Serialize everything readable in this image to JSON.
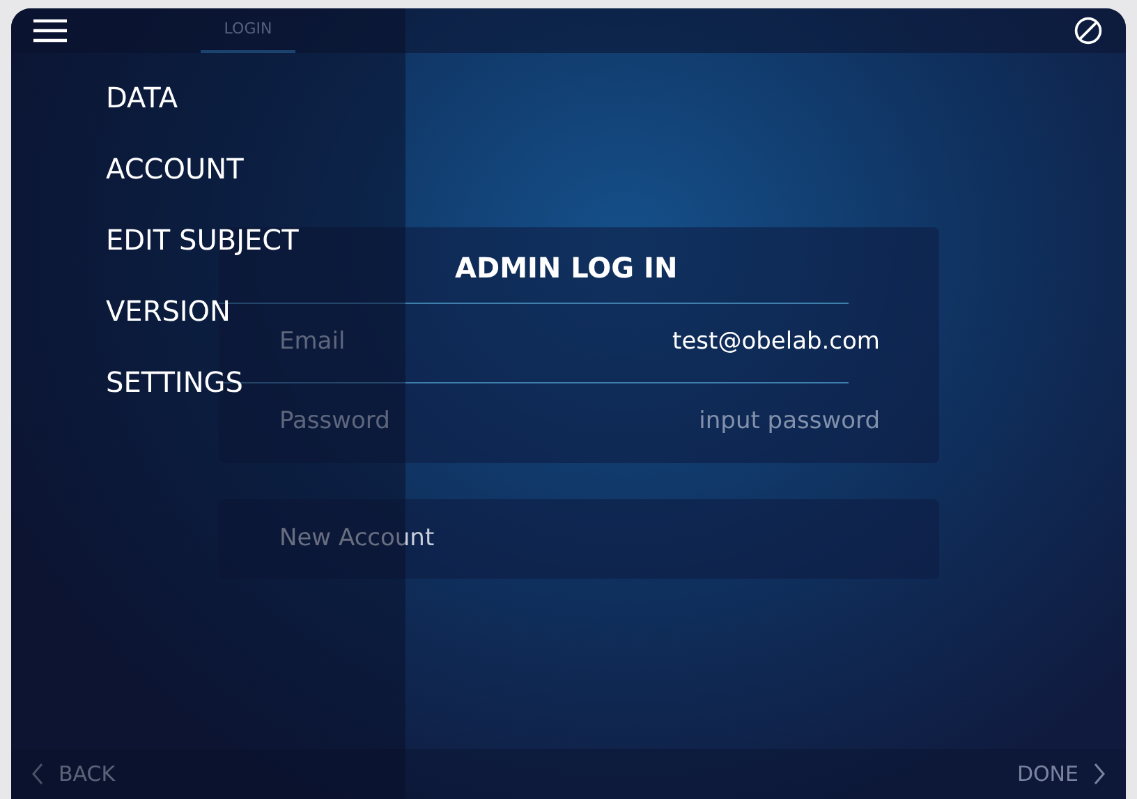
{
  "top_bar": {
    "tabs": [
      {
        "label": "LOGIN",
        "selected": true
      }
    ]
  },
  "drawer": {
    "items": [
      {
        "label": "DATA"
      },
      {
        "label": "ACCOUNT"
      },
      {
        "label": "EDIT SUBJECT"
      },
      {
        "label": "VERSION"
      },
      {
        "label": "SETTINGS"
      }
    ]
  },
  "login_card": {
    "title": "ADMIN LOG IN",
    "fields": [
      {
        "label": "Email",
        "value": "test@obelab.com",
        "kind": "text"
      },
      {
        "label": "Password",
        "placeholder": "input password",
        "kind": "password"
      }
    ]
  },
  "new_account": {
    "label": "New Account"
  },
  "footer": {
    "back": {
      "label": "BACK"
    },
    "done": {
      "label": "DONE",
      "disabled": true
    }
  }
}
